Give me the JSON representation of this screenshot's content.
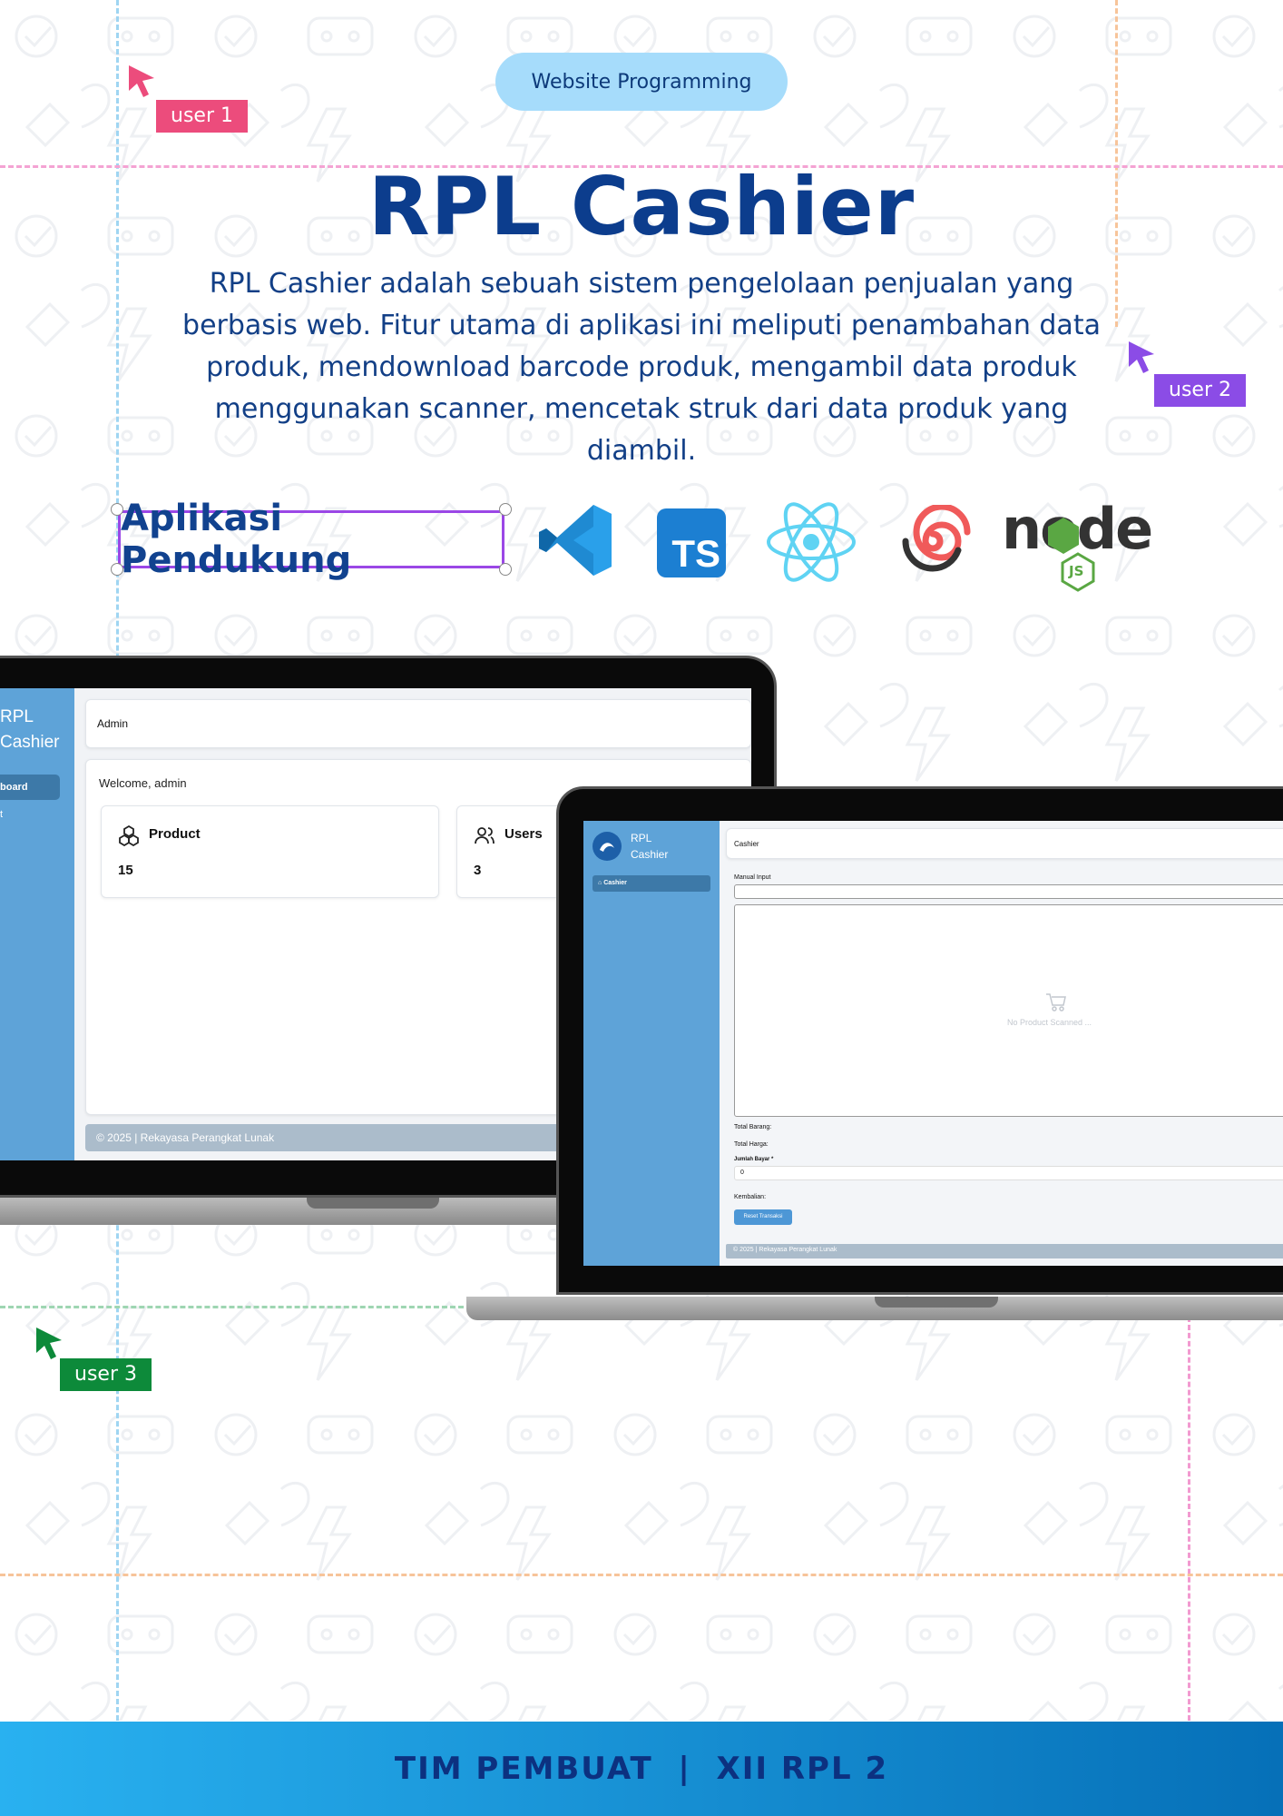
{
  "badge": {
    "label": "Website Programming"
  },
  "title": "RPL Cashier",
  "description": "RPL Cashier adalah sebuah sistem pengelolaan penjualan yang berbasis web. Fitur utama di aplikasi ini meliputi penambahan data produk, mendownload barcode produk, mengambil data produk menggunakan scanner, mencetak struk dari data produk yang diambil.",
  "cursors": [
    {
      "label": "user 1",
      "color": "#ec4c7c"
    },
    {
      "label": "user 2",
      "color": "#8b4ce6"
    },
    {
      "label": "user 3",
      "color": "#0d8a3a"
    }
  ],
  "supporting_apps": {
    "label": "Aplikasi Pendukung",
    "icons": [
      "vscode-icon",
      "typescript-icon",
      "react-icon",
      "swirl-logo-icon",
      "nodejs-icon"
    ],
    "ts_text": "TS",
    "node_text": "node",
    "js_text": "JS"
  },
  "dashboard": {
    "brand_line1": "RPL",
    "brand_line2": "Cashier",
    "nav_active": "board",
    "nav_second": "t",
    "header": "Admin",
    "welcome": "Welcome, admin",
    "cards": [
      {
        "title": "Product",
        "value": "15",
        "icon": "product-cubes-icon"
      },
      {
        "title": "Users",
        "value": "3",
        "icon": "users-icon"
      }
    ],
    "footer": "© 2025 | Rekayasa Perangkat Lunak"
  },
  "cashier": {
    "brand_line1": "RPL",
    "brand_line2": "Cashier",
    "nav_active": "Cashier",
    "header": "Cashier",
    "manual_input_label": "Manual Input",
    "empty_text": "No Product Scanned ...",
    "total_items_label": "Total Barang:",
    "total_price_label": "Total Harga:",
    "pay_amount_label": "Jumlah Bayar *",
    "pay_amount_value": "0",
    "change_label": "Kembalian:",
    "reset_button": "Reset Transaksi",
    "footer": "© 2025 | Rekayasa Perangkat Lunak"
  },
  "footer": {
    "text": "TIM PEMBUAT  |  XII RPL 2"
  }
}
